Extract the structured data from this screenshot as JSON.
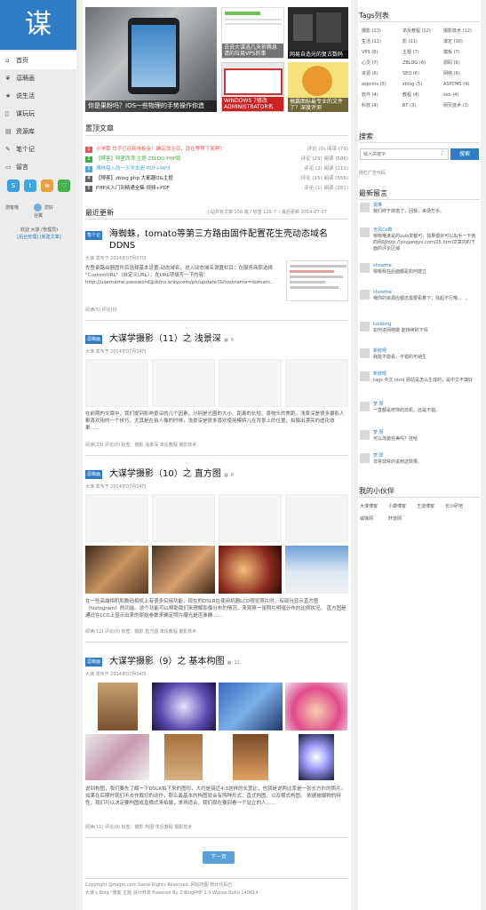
{
  "logo": {
    "text": "谋"
  },
  "nav": [
    {
      "label": "首页",
      "icon": "home-icon",
      "glyph": "⌂",
      "active": true
    },
    {
      "label": "逗萌画",
      "icon": "leaf-icon",
      "glyph": "❦"
    },
    {
      "label": "说生活",
      "icon": "star-icon",
      "glyph": "★"
    },
    {
      "label": "谋玩玩",
      "icon": "phone-icon",
      "glyph": "▯"
    },
    {
      "label": "资源库",
      "icon": "folder-icon",
      "glyph": "▤"
    },
    {
      "label": "笔个记",
      "icon": "pen-icon",
      "glyph": "✎"
    },
    {
      "label": "留言",
      "icon": "chat-icon",
      "glyph": "▭"
    }
  ],
  "social": [
    {
      "name": "qzone-icon",
      "glyph": "S",
      "color": "#3c9ee0"
    },
    {
      "name": "tencent-weibo-icon",
      "glyph": "t",
      "color": "#41a7e0"
    },
    {
      "name": "sina-weibo-icon",
      "glyph": "w",
      "color": "#e6a23c"
    },
    {
      "name": "wechat-icon",
      "glyph": "♡",
      "color": "#46b04a"
    }
  ],
  "user": {
    "visitor": "游客哦",
    "greet": "欢迎 大谋 (管理员)",
    "links": "[后台管理] [新建文章]",
    "you": "您好",
    "me": "谷翼"
  },
  "featured": [
    {
      "caption": "你是果粉吗？IOS一些物理的手势操作你造"
    },
    {
      "caption": "说说大谋选几天折腾息请的垃圾VPS的事"
    },
    {
      "caption": "网易自造光的复古数码"
    },
    {
      "caption": "WINDOWS 7修改ADMINISTRATOR名"
    },
    {
      "caption": "搞篇图标最专业的文件了？深度评测"
    }
  ],
  "top_title": "置顶文章",
  "top_posts": [
    {
      "num": "1",
      "color": "#e05b5b",
      "title": "小学黄 饺子已经新地板金！确定改主目，现在等等下来啊！",
      "comments": "评论 (0)",
      "views": "阅读 (79)"
    },
    {
      "num": "2",
      "color": "#3fae49",
      "title": "【博客】阿里西湾 主题 ZBLOG PHP版",
      "comments": "评论 (29)",
      "views": "阅读 (586)"
    },
    {
      "num": "3",
      "color": "#49a6e0",
      "title": "博林蕴入的一天学本册 PDF+MP3",
      "comments": "评论 (2)",
      "views": "阅读 (211)"
    },
    {
      "num": "4",
      "color": "#666666",
      "title": "【博客】zblog php 大都趣D&主题",
      "comments": "评论 (15)",
      "views": "阅读 (556)"
    },
    {
      "num": "5",
      "color": "#666666",
      "title": "PHP从入门到精通全集 视频+PDF",
      "comments": "评论 (1)",
      "views": "阅读 (281)"
    }
  ],
  "latest_title": "最近更新",
  "latest_stats": "小站共有文章 150 篇 / 标签 129 个 / 最后更新 2014-07-07",
  "posts": [
    {
      "badge": "笔个记",
      "title": "海蜘蛛，tomato等第三方路由固件配置花生壳动态域名DDNS",
      "date": "大谋 发布于 2014年07月07日",
      "excerpt": "先登录路由器固件后选择基本设置-动态域名，进入动态域名设置栏目：在服务商那选择 \"CustomURL\"（自定义URL）；在URL项填写一下内容：http://username:password@ddns.oray.com/ph/update?&hostname=domain...",
      "footer": "阅读(5)   评论(0)"
    },
    {
      "badge": "逗萌画",
      "title": "大谋学摄影（11）之 浅景深",
      "date": "大谋 发布于 2014年07月04日",
      "count": "6",
      "excerpt": "在前期的文章中，我们提到影响景深的几个因素，分别是光圈的大小、距离的长短、景物头的焦距。浅景深是很多摄影人都喜欢用的一个技巧，尤其是在拍人像的时候，浅景深是很多喜欢使用模特儿在背景上的位置，拍摄出漂亮的虚化效果……",
      "footer": "阅读(23)   评论(0)     标签：摄影 浅景深 单反教程 摄影技术"
    },
    {
      "badge": "逗萌画",
      "title": "大谋学摄影（10）之 直方图",
      "date": "大谋 发布于 2014年07月04日",
      "count": "8",
      "excerpt": "在一些高端相机和数码相机上有很多实用功能，现在的DSLR在使用机器LCD预览照片时，有部分显示直方图（histogram）的功能。这个功能可以帮助我们来理解影像分布的情况，来观察一张照片明暗分布的比例状况。 直方图是通过在LCD上显示出来的原始参数来确定照片曝光是否准确……",
      "footer": "阅读(12)   评论(0)     标签：摄影 直方图 单反教程 摄影技术"
    },
    {
      "badge": "逗萌画",
      "title": "大谋学摄影（9）之 基本构图",
      "date": "大谋 发布于 2014年07月04日",
      "count": "11",
      "excerpt": "说到构图，我们要先了解一下DSLR拍下来的图形，大约是接近4:3这样的长宽比，也就是说两比率是一张长方形的照片。如果在后期时我们不去作裁切的动作，那么最基本的构图就会有两种形式：直式构图、以及横式构图。 依据被摄物的特性，我们可以决定要构图成直横式来拍摄，求得适合，我们现在要别看一个站立的人……",
      "footer": "阅读(11)   评论(0)     标签：摄影 构图 单反教程 摄影技术"
    }
  ],
  "pager": {
    "next": "下一页"
  },
  "footer": {
    "line1": "Copyright @migm.com Some Rights Reserved.  网站地图  统计代码已",
    "line2": "大谋's Blog \"博客 主题 说计开发 Powered By Z-BlogPHP 1.3 Wonse Build 140614"
  },
  "tags_title": "Tags列表",
  "tags": [
    [
      "摄影 (13)",
      "单反教程 (12)",
      "摄影技术 (12)"
    ],
    [
      "生活 (11)",
      "影 (11)",
      "谋定 (10)"
    ],
    [
      "VPS (8)",
      "主题 (7)",
      "模板 (7)"
    ],
    [
      "心灵 (7)",
      "ZBLOG (6)",
      "源码 (6)"
    ],
    [
      "资源 (6)",
      "SEO (6)",
      "网络 (6)"
    ],
    [
      "aspcms (5)",
      "zblog (5)",
      "ASPCMS (4)"
    ],
    [
      "软件 (4)",
      "教程 (4)",
      "seo (4)"
    ],
    [
      "科技 (4)",
      "BT (3)",
      "网页技术 (3)"
    ]
  ],
  "search": {
    "title": "搜索",
    "placeholder": "输入关键字",
    "button": "搜索",
    "ad": "侧栏广告代码"
  },
  "comments_title": "最新留言",
  "comments": [
    {
      "name": "需难",
      "text": "我们终于搞搭了，回我，来便万手。"
    },
    {
      "name": "吉风Co数",
      "text": "嗯嗯哦诶是的zulo发都可，如果很好可以出手一下他的网站http://yingangyu.com/25.html文章内的下面的评论区域"
    },
    {
      "name": "showme",
      "text": "嗯嗯我在后面都是如何建立"
    },
    {
      "name": "showme",
      "text": "哦你的资源应都还需要看着下，找起不行哦。， 。"
    },
    {
      "name": "luodong",
      "text": "如何进网络做 能持续的下吗"
    },
    {
      "name": "新鲜呀",
      "text": "我能不能看，不错的可纳生"
    },
    {
      "name": "新鲜呀",
      "text": "tags 中文.html 网站是怎么生成的，是中文不填好"
    },
    {
      "name": "梦.厚",
      "text": "一直都是修饰的非机，还是不错。"
    },
    {
      "name": "梦.厚",
      "text": "可以改装完美吗？挂哈"
    },
    {
      "name": "梦.厚",
      "text": "非常非常的说到这效果。"
    }
  ],
  "friends_title": "我的小伙伴",
  "friends": [
    [
      "大谋博客",
      "小康博客",
      "王迪博客",
      "长沙研地"
    ],
    [
      "威锋网",
      "轩逸网"
    ]
  ]
}
